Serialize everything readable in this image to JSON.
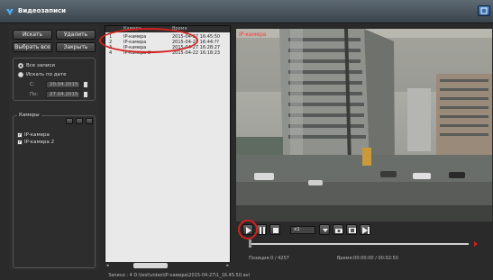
{
  "window": {
    "title": "Видеозаписи"
  },
  "left": {
    "search_button": "Искать",
    "delete_button": "Удалить",
    "select_all_button": "Выбрать все",
    "close_button": "Закрыть",
    "filter": {
      "all_records": "Все записи",
      "search_by_date": "Искать по дате",
      "from_label": "С:",
      "from_value": "20.04.2015",
      "to_label": "По:",
      "to_value": "27.04.2015"
    },
    "cameras": {
      "label": "Камеры",
      "items": [
        {
          "label": "IP-камера",
          "checked": true
        },
        {
          "label": "IP-камера 2",
          "checked": true
        }
      ]
    }
  },
  "records": {
    "columns": [
      "",
      "Камера",
      "Время"
    ],
    "rows": [
      {
        "num": "1",
        "camera": "IP-камера",
        "time": "2015-04-27 16:45:50"
      },
      {
        "num": "2",
        "camera": "IP-камера",
        "time": "2015-04-27 16:44:??"
      },
      {
        "num": "3",
        "camera": "IP-камера",
        "time": "2015-04-27 16:28:27"
      },
      {
        "num": "4",
        "camera": "IP-камера 2",
        "time": "2015-04-22 16:18:23"
      }
    ]
  },
  "video": {
    "label": "IP-камера",
    "speed": "x1",
    "position": "Позиция:0 / 4257",
    "time": "Время:00:00:00 / 00:02:50",
    "progress": 0
  },
  "status": {
    "text": "Записи : 4   D:\\test\\video\\IP-камера\\2015-04-27\\1_16.45.50.avi"
  },
  "colors": {
    "highlight": "#d42020",
    "camera_label": "#ff3a3a"
  }
}
